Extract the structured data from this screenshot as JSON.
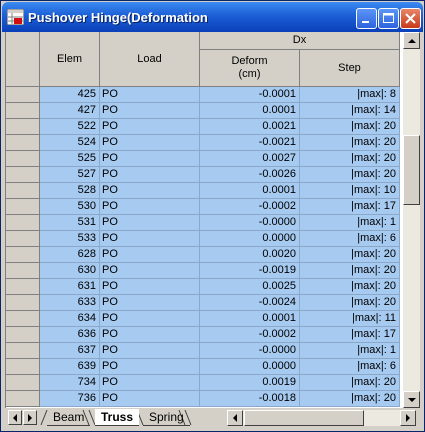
{
  "window": {
    "title": "Pushover Hinge(Deformation"
  },
  "table": {
    "headers": {
      "elem": "Elem",
      "load": "Load",
      "group": "Dx",
      "deform": "Deform\n(cm)",
      "step": "Step"
    },
    "rows": [
      {
        "elem": "425",
        "load": "PO",
        "deform": "-0.0001",
        "step": "|max|: 8"
      },
      {
        "elem": "427",
        "load": "PO",
        "deform": "0.0001",
        "step": "|max|: 14"
      },
      {
        "elem": "522",
        "load": "PO",
        "deform": "0.0021",
        "step": "|max|: 20"
      },
      {
        "elem": "524",
        "load": "PO",
        "deform": "-0.0021",
        "step": "|max|: 20"
      },
      {
        "elem": "525",
        "load": "PO",
        "deform": "0.0027",
        "step": "|max|: 20"
      },
      {
        "elem": "527",
        "load": "PO",
        "deform": "-0.0026",
        "step": "|max|: 20"
      },
      {
        "elem": "528",
        "load": "PO",
        "deform": "0.0001",
        "step": "|max|: 10"
      },
      {
        "elem": "530",
        "load": "PO",
        "deform": "-0.0002",
        "step": "|max|: 17"
      },
      {
        "elem": "531",
        "load": "PO",
        "deform": "-0.0000",
        "step": "|max|: 1"
      },
      {
        "elem": "533",
        "load": "PO",
        "deform": "0.0000",
        "step": "|max|: 6"
      },
      {
        "elem": "628",
        "load": "PO",
        "deform": "0.0020",
        "step": "|max|: 20"
      },
      {
        "elem": "630",
        "load": "PO",
        "deform": "-0.0019",
        "step": "|max|: 20"
      },
      {
        "elem": "631",
        "load": "PO",
        "deform": "0.0025",
        "step": "|max|: 20"
      },
      {
        "elem": "633",
        "load": "PO",
        "deform": "-0.0024",
        "step": "|max|: 20"
      },
      {
        "elem": "634",
        "load": "PO",
        "deform": "0.0001",
        "step": "|max|: 11"
      },
      {
        "elem": "636",
        "load": "PO",
        "deform": "-0.0002",
        "step": "|max|: 17"
      },
      {
        "elem": "637",
        "load": "PO",
        "deform": "-0.0000",
        "step": "|max|: 1"
      },
      {
        "elem": "639",
        "load": "PO",
        "deform": "0.0000",
        "step": "|max|: 6"
      },
      {
        "elem": "734",
        "load": "PO",
        "deform": "0.0019",
        "step": "|max|: 20"
      },
      {
        "elem": "736",
        "load": "PO",
        "deform": "-0.0018",
        "step": "|max|: 20"
      }
    ]
  },
  "tabs": [
    {
      "label": "Beam",
      "active": false
    },
    {
      "label": "Truss",
      "active": true
    },
    {
      "label": "Spring",
      "active": false
    }
  ],
  "colors": {
    "selection": "#a6caf0",
    "titlebar": "#0a3fb8"
  },
  "icons": [
    "app-icon",
    "minimize-icon",
    "maximize-icon",
    "close-icon",
    "scroll-up-icon",
    "scroll-down-icon",
    "scroll-left-icon",
    "scroll-right-icon",
    "tab-prev-icon",
    "tab-next-icon"
  ]
}
